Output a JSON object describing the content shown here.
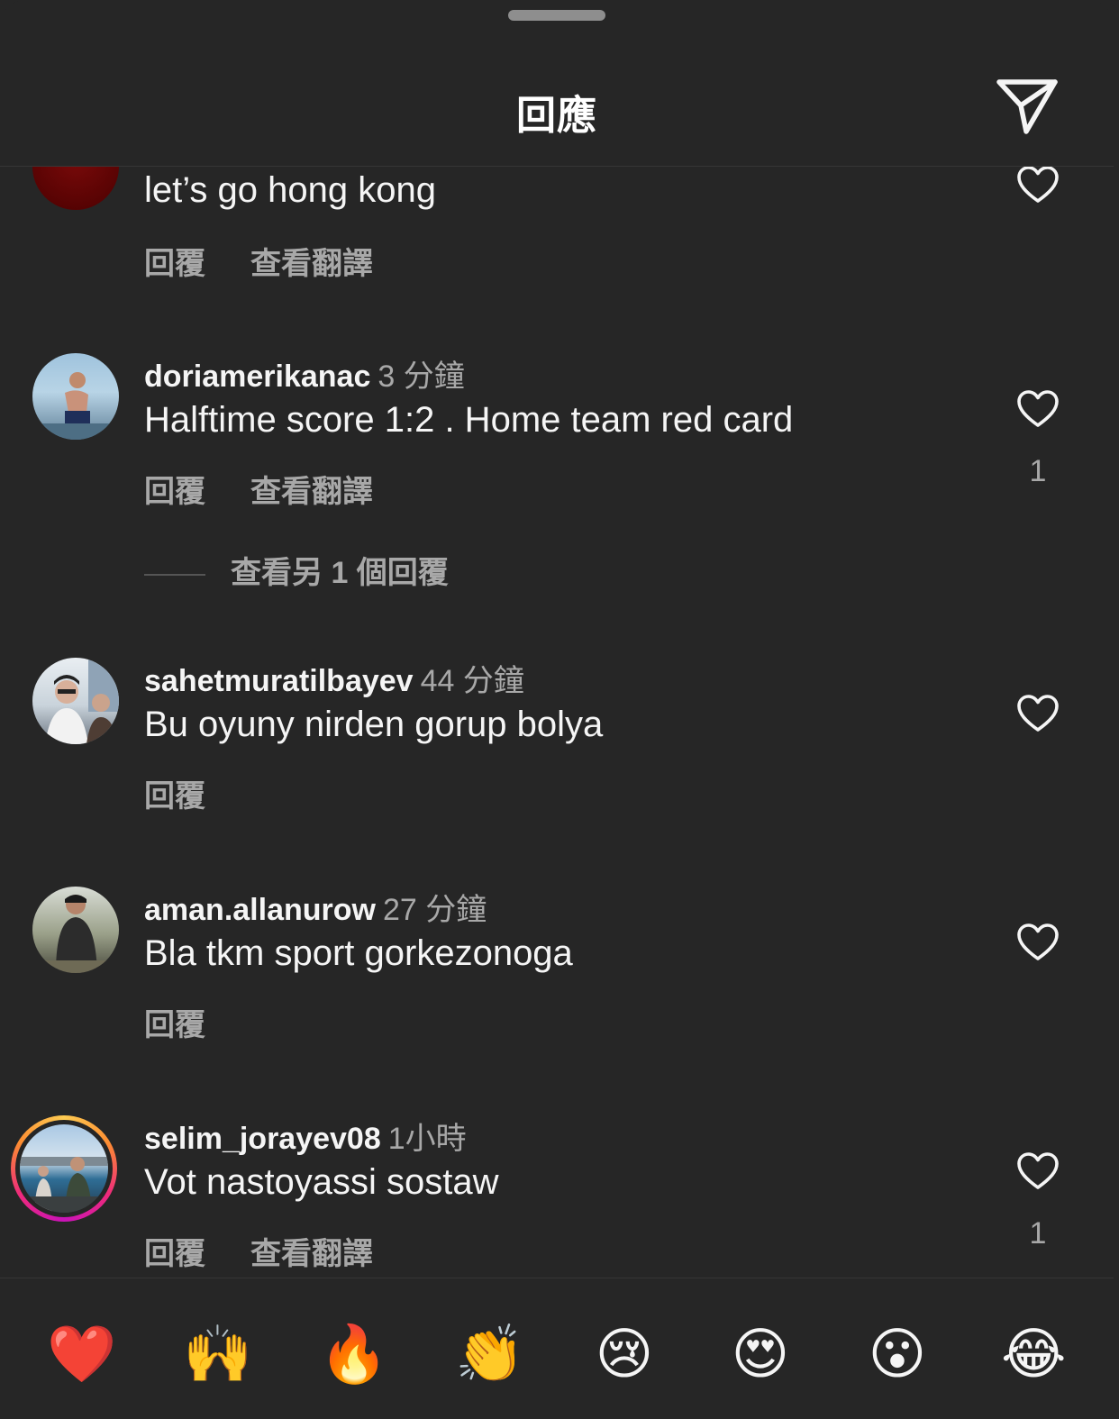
{
  "header": {
    "title": "回應"
  },
  "comments": [
    {
      "username": "",
      "time": "",
      "text": "let’s go hong kong",
      "reply": "回覆",
      "translate": "查看翻譯",
      "likes": ""
    },
    {
      "username": "doriamerikanac",
      "time": "3 分鐘",
      "text": "Halftime score 1:2 . Home team red card",
      "reply": "回覆",
      "translate": "查看翻譯",
      "likes": "1",
      "more_replies": "查看另 1 個回覆"
    },
    {
      "username": "sahetmuratilbayev",
      "time": "44 分鐘",
      "text": "Bu oyuny nirden gorup bolya",
      "reply": "回覆",
      "translate": "",
      "likes": ""
    },
    {
      "username": "aman.allanurow",
      "time": "27 分鐘",
      "text": "Bla tkm sport gorkezonoga",
      "reply": "回覆",
      "translate": "",
      "likes": ""
    },
    {
      "username": "selim_jorayev08",
      "time": "1小時",
      "text": "Vot nastoyassi sostaw",
      "reply": "回覆",
      "translate": "查看翻譯",
      "likes": "1"
    }
  ],
  "reactions": [
    "❤️",
    "🙌",
    "🔥",
    "👏",
    "😢",
    "😍",
    "😮",
    "😂"
  ],
  "icons": {
    "send": "send-icon",
    "like": "heart-outline-icon"
  },
  "colors": {
    "background": "#262626",
    "primary_text": "#f5f5f5",
    "secondary_text": "#a8a8a8"
  }
}
